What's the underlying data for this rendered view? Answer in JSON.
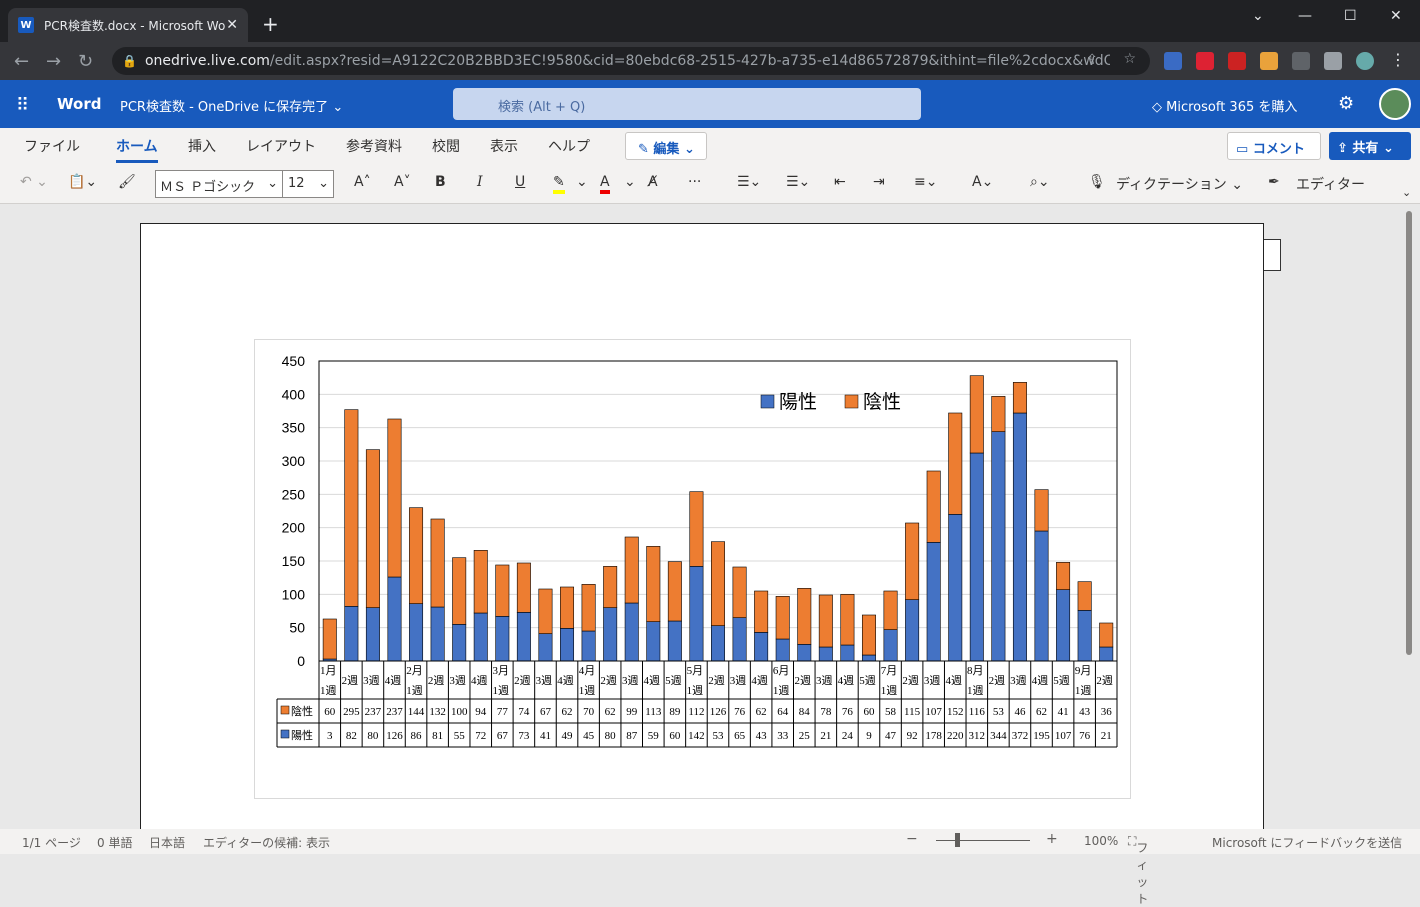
{
  "browser": {
    "tab_title": "PCR検査数.docx - Microsoft Word",
    "url_domain": "onedrive.live.com",
    "url_path": "/edit.aspx?resid=A9122C20B2BBD3EC!9580&cid=80ebdc68-2515-427b-a735-e14d86572879&ithint=file%2cdocx&wdOrigin=OFFICE..."
  },
  "app": {
    "name": "Word",
    "doc_name": "PCR検査数",
    "save_status": "- OneDrive に保存完了",
    "search_placeholder": "検索 (Alt + Q)",
    "buy_label": "Microsoft 365 を購入"
  },
  "menu": {
    "file": "ファイル",
    "home": "ホーム",
    "insert": "挿入",
    "layout": "レイアウト",
    "references": "参考資料",
    "review": "校閲",
    "view": "表示",
    "help": "ヘルプ",
    "edit": "編集",
    "comment": "コメント",
    "share": "共有"
  },
  "toolbar": {
    "font": "ＭＳ Ｐゴシック",
    "size": "12",
    "dictate": "ディクテーション",
    "editor": "エディター"
  },
  "status": {
    "page": "1/1 ページ",
    "words": "0 単語",
    "lang": "日本語",
    "editor_hint": "エディターの候補: 表示",
    "zoom": "100%",
    "fit": "フィット",
    "feedback": "Microsoft にフィードバックを送信"
  },
  "chart_data": {
    "type": "bar",
    "stacked": true,
    "categories": [
      [
        "1月",
        "1週"
      ],
      [
        "2週"
      ],
      [
        "3週"
      ],
      [
        "4週"
      ],
      [
        "2月",
        "1週"
      ],
      [
        "2週"
      ],
      [
        "3週"
      ],
      [
        "4週"
      ],
      [
        "3月",
        "1週"
      ],
      [
        "2週"
      ],
      [
        "3週"
      ],
      [
        "4週"
      ],
      [
        "4月",
        "1週"
      ],
      [
        "2週"
      ],
      [
        "3週"
      ],
      [
        "4週"
      ],
      [
        "5週"
      ],
      [
        "5月",
        "1週"
      ],
      [
        "2週"
      ],
      [
        "3週"
      ],
      [
        "4週"
      ],
      [
        "6月",
        "1週"
      ],
      [
        "2週"
      ],
      [
        "3週"
      ],
      [
        "4週"
      ],
      [
        "5週"
      ],
      [
        "7月",
        "1週"
      ],
      [
        "2週"
      ],
      [
        "3週"
      ],
      [
        "4週"
      ],
      [
        "8月",
        "1週"
      ],
      [
        "2週"
      ],
      [
        "3週"
      ],
      [
        "4週"
      ],
      [
        "5週"
      ],
      [
        "9月",
        "1週"
      ],
      [
        "2週"
      ]
    ],
    "series": [
      {
        "name": "陽性",
        "color": "#4472c4",
        "values": [
          3,
          82,
          80,
          126,
          86,
          81,
          55,
          72,
          67,
          73,
          41,
          49,
          45,
          80,
          87,
          59,
          60,
          142,
          53,
          65,
          43,
          33,
          25,
          21,
          24,
          9,
          47,
          92,
          178,
          220,
          312,
          344,
          372,
          195,
          107,
          76,
          21
        ]
      },
      {
        "name": "陰性",
        "color": "#ed7d31",
        "values": [
          60,
          295,
          237,
          237,
          144,
          132,
          100,
          94,
          77,
          74,
          67,
          62,
          70,
          62,
          99,
          113,
          89,
          112,
          126,
          76,
          62,
          64,
          84,
          78,
          76,
          60,
          58,
          115,
          107,
          152,
          116,
          53,
          46,
          62,
          41,
          43,
          36
        ]
      }
    ],
    "yticks": [
      "450",
      "400",
      "350",
      "300",
      "250",
      "200",
      "150",
      "100",
      "50",
      "0"
    ],
    "ylim": [
      0,
      450
    ],
    "legend_position": "top-right inside",
    "grid": true
  }
}
